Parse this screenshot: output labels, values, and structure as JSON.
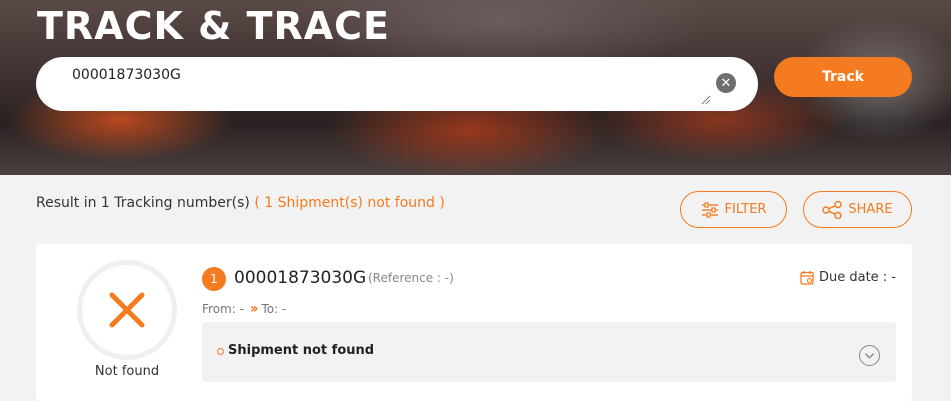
{
  "header": {
    "title": "TRACK & TRACE"
  },
  "search": {
    "value": "00001873030G",
    "clear_icon": "close-circle-icon",
    "track_label": "Track"
  },
  "results": {
    "summary": "Result in 1 Tracking number(s)",
    "not_found_note": "( 1 Shipment(s) not found )",
    "filter_label": "FILTER",
    "share_label": "SHARE"
  },
  "shipment": {
    "index": "1",
    "tracking_number": "00001873030G",
    "reference": "(Reference : -)",
    "due_date": "Due date : -",
    "from": "From: -",
    "to": "To: -",
    "status_label": "Not found",
    "status_message": "Shipment not found"
  },
  "colors": {
    "accent": "#f47b20",
    "panel": "#f2f2f2"
  }
}
